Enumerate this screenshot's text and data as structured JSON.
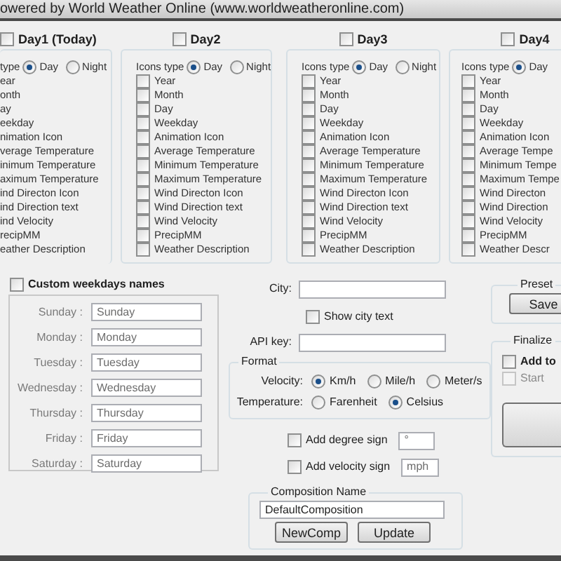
{
  "header": {
    "text": "owered by World Weather Online (www.worldweatheronline.com)"
  },
  "days": [
    {
      "label": "Day1 (Today)",
      "checked": false,
      "icons_type_label": "type",
      "icon_options": [
        {
          "label": "Day",
          "selected": true
        },
        {
          "label": "Night",
          "selected": false
        }
      ],
      "items": [
        {
          "label": "ear"
        },
        {
          "label": "onth"
        },
        {
          "label": "ay"
        },
        {
          "label": "eekday"
        },
        {
          "label": "nimation Icon"
        },
        {
          "label": "verage Temperature"
        },
        {
          "label": "inimum Temperature"
        },
        {
          "label": "aximum Temperature"
        },
        {
          "label": "ind Directon Icon"
        },
        {
          "label": "ind Direction text"
        },
        {
          "label": "ind Velocity"
        },
        {
          "label": "recipMM"
        },
        {
          "label": "eather Description"
        }
      ]
    },
    {
      "label": "Day2",
      "checked": false,
      "icons_type_label": "Icons type",
      "icon_options": [
        {
          "label": "Day",
          "selected": true
        },
        {
          "label": "Night",
          "selected": false
        }
      ],
      "items": [
        {
          "label": "Year",
          "checked": false
        },
        {
          "label": "Month",
          "checked": false
        },
        {
          "label": "Day",
          "checked": false
        },
        {
          "label": "Weekday",
          "checked": false
        },
        {
          "label": "Animation Icon",
          "checked": false
        },
        {
          "label": "Average Temperature",
          "checked": false
        },
        {
          "label": "Minimum Temperature",
          "checked": false
        },
        {
          "label": "Maximum Temperature",
          "checked": false
        },
        {
          "label": "Wind Directon Icon",
          "checked": false
        },
        {
          "label": "Wind Direction text",
          "checked": false
        },
        {
          "label": "Wind Velocity",
          "checked": false
        },
        {
          "label": "PrecipMM",
          "checked": false
        },
        {
          "label": "Weather Description",
          "checked": false
        }
      ]
    },
    {
      "label": "Day3",
      "checked": false,
      "icons_type_label": "Icons type",
      "icon_options": [
        {
          "label": "Day",
          "selected": true
        },
        {
          "label": "Night",
          "selected": false
        }
      ],
      "items": [
        {
          "label": "Year",
          "checked": false
        },
        {
          "label": "Month",
          "checked": false
        },
        {
          "label": "Day",
          "checked": false
        },
        {
          "label": "Weekday",
          "checked": false
        },
        {
          "label": "Animation Icon",
          "checked": false
        },
        {
          "label": "Average Temperature",
          "checked": false
        },
        {
          "label": "Minimum Temperature",
          "checked": false
        },
        {
          "label": "Maximum Temperature",
          "checked": false
        },
        {
          "label": "Wind Directon Icon",
          "checked": false
        },
        {
          "label": "Wind Direction text",
          "checked": false
        },
        {
          "label": "Wind Velocity",
          "checked": false
        },
        {
          "label": "PrecipMM",
          "checked": false
        },
        {
          "label": "Weather Description",
          "checked": false
        }
      ]
    },
    {
      "label": "Day4",
      "checked": false,
      "icons_type_label": "Icons type",
      "icon_options": [
        {
          "label": "Day",
          "selected": true
        }
      ],
      "items": [
        {
          "label": "Year",
          "checked": false
        },
        {
          "label": "Month",
          "checked": false
        },
        {
          "label": "Day",
          "checked": false
        },
        {
          "label": "Weekday",
          "checked": false
        },
        {
          "label": "Animation Icon",
          "checked": false
        },
        {
          "label": "Average Tempe",
          "checked": false
        },
        {
          "label": "Minimum Tempe",
          "checked": false
        },
        {
          "label": "Maximum Tempe",
          "checked": false
        },
        {
          "label": "Wind Directon",
          "checked": false
        },
        {
          "label": "Wind Direction",
          "checked": false
        },
        {
          "label": "Wind Velocity",
          "checked": false
        },
        {
          "label": "PrecipMM",
          "checked": false
        },
        {
          "label": "Weather Descr",
          "checked": false
        }
      ]
    }
  ],
  "custom_weekdays": {
    "label": "Custom weekdays names",
    "checked": false,
    "rows": [
      {
        "label": "Sunday :",
        "value": "Sunday"
      },
      {
        "label": "Monday :",
        "value": "Monday"
      },
      {
        "label": "Tuesday :",
        "value": "Tuesday"
      },
      {
        "label": "Wednesday :",
        "value": "Wednesday"
      },
      {
        "label": "Thursday :",
        "value": "Thursday"
      },
      {
        "label": "Friday :",
        "value": "Friday"
      },
      {
        "label": "Saturday :",
        "value": "Saturday"
      }
    ]
  },
  "city": {
    "label": "City:"
  },
  "show_city_text": {
    "label": "Show city text",
    "checked": false
  },
  "api_key": {
    "label": "API key:"
  },
  "format": {
    "title": "Format",
    "velocity": {
      "label": "Velocity:",
      "options": [
        {
          "label": "Km/h",
          "selected": true
        },
        {
          "label": "Mile/h",
          "selected": false
        },
        {
          "label": "Meter/s",
          "selected": false
        }
      ]
    },
    "temperature": {
      "label": "Temperature:",
      "options": [
        {
          "label": "Farenheit",
          "selected": false
        },
        {
          "label": "Celsius",
          "selected": true
        }
      ]
    }
  },
  "add_degree_sign": {
    "label": "Add degree sign",
    "checked": false,
    "value": "°"
  },
  "add_velocity_sign": {
    "label": "Add velocity sign",
    "checked": false,
    "value": "mph"
  },
  "composition": {
    "title": "Composition Name",
    "value": "DefaultComposition",
    "buttons": [
      "NewComp",
      "Update"
    ]
  },
  "preset": {
    "title": "Preset",
    "buttons": [
      "Save"
    ]
  },
  "finalize": {
    "title": "Finalize",
    "options": [
      {
        "label": "Add to",
        "checked": false,
        "disabled": false
      },
      {
        "label": "Start",
        "checked": false,
        "disabled": true
      }
    ]
  }
}
